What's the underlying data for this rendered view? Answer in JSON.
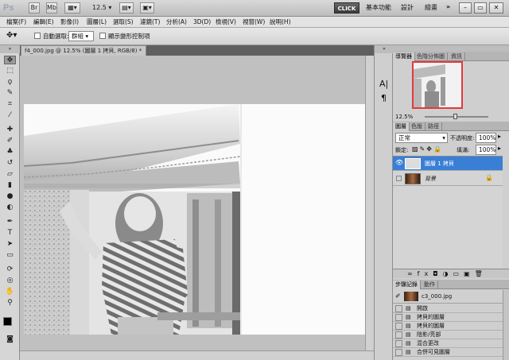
{
  "app": {
    "logo": "Ps",
    "zoom": "12.5",
    "click_label": "CLICK",
    "workspaces": [
      "基本功能",
      "設計",
      "繪畫"
    ],
    "more": "»"
  },
  "menu": [
    "檔案(F)",
    "編輯(E)",
    "影像(I)",
    "圖層(L)",
    "選取(S)",
    "濾鏡(T)",
    "分析(A)",
    "3D(D)",
    "檢視(V)",
    "視窗(W)",
    "說明(H)"
  ],
  "options": {
    "auto_select_label": "自動選取:",
    "auto_select_value": "群組",
    "show_transform_label": "顯示變形控制項"
  },
  "document": {
    "tab_title": "f4_000.jpg @ 12.5% (圖層 1 拷貝, RGB/8) *",
    "close": "×"
  },
  "navigator": {
    "tabs": [
      "導覽器",
      "色階分佈圖",
      "資訊"
    ],
    "zoom": "12.5%"
  },
  "layers": {
    "tabs": [
      "圖層",
      "色版",
      "路徑"
    ],
    "blend_mode": "正常",
    "opacity_label": "不透明度:",
    "opacity": "100%",
    "lock_label": "鎖定:",
    "fill_label": "填滿:",
    "fill": "100%",
    "items": [
      {
        "name": "圖層 1 拷貝",
        "selected": true
      },
      {
        "name": "背景",
        "selected": false
      }
    ]
  },
  "history": {
    "tabs": [
      "步驟記錄",
      "動作"
    ],
    "snapshot": "c3_000.jpg",
    "items": [
      "開啟",
      "拷貝的圖層",
      "拷貝的圖層",
      "陰影/亮部",
      "混合更改",
      "合併可見圖層"
    ]
  },
  "colors": {
    "accent": "#3c7fd1",
    "selected_layer": "#3a7fd6",
    "nav_frame": "#e23a3a"
  }
}
